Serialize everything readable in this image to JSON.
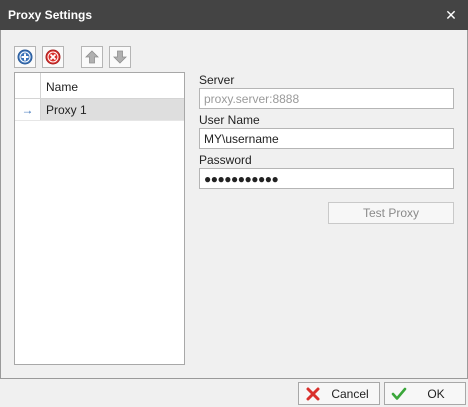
{
  "window": {
    "title": "Proxy Settings",
    "close_glyph": "✕"
  },
  "toolbar": {
    "add_icon": "add-circle-icon",
    "remove_icon": "remove-circle-icon",
    "up_icon": "arrow-up-icon",
    "down_icon": "arrow-down-icon"
  },
  "grid": {
    "column_header": "Name",
    "rows": [
      {
        "indicator": "→",
        "name": "Proxy 1"
      }
    ]
  },
  "form": {
    "server_label": "Server",
    "server_placeholder": "proxy.server:8888",
    "username_label": "User Name",
    "username_value": "MY\\username",
    "password_label": "Password",
    "password_mask": "●●●●●●●●●●●",
    "test_label": "Test Proxy"
  },
  "buttons": {
    "cancel": "Cancel",
    "ok": "OK"
  },
  "colors": {
    "titlebar": "#444444",
    "accent_blue": "#3a72b8",
    "remove_red": "#d9302c",
    "ok_green": "#3aa63a"
  }
}
